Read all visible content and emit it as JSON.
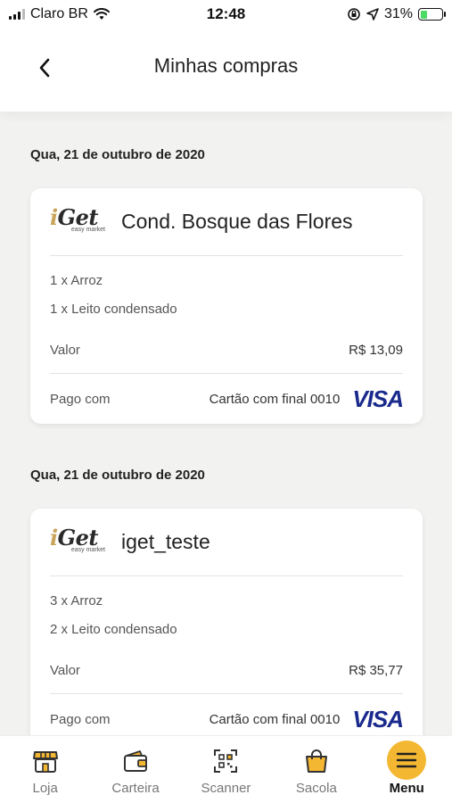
{
  "status": {
    "carrier": "Claro BR",
    "time": "12:48",
    "battery": "31%",
    "battery_level": 0.31
  },
  "header": {
    "title": "Minhas compras"
  },
  "orders": [
    {
      "date": "Qua, 21 de outubro de 2020",
      "logo": {
        "main": "iGet",
        "sub": "easy market"
      },
      "store": "Cond. Bosque das Flores",
      "items": [
        "1 x Arroz",
        "1 x Leito condensado"
      ],
      "valor_label": "Valor",
      "valor": "R$ 13,09",
      "pago_label": "Pago com",
      "card": "Cartão com final 0010",
      "brand": "VISA"
    },
    {
      "date": "Qua, 21 de outubro de 2020",
      "logo": {
        "main": "iGet",
        "sub": "easy market"
      },
      "store": "iget_teste",
      "items": [
        "3 x Arroz",
        "2 x Leito condensado"
      ],
      "valor_label": "Valor",
      "valor": "R$ 35,77",
      "pago_label": "Pago com",
      "card": "Cartão com final 0010",
      "brand": "VISA"
    }
  ],
  "tabs": [
    {
      "label": "Loja",
      "icon": "store-icon"
    },
    {
      "label": "Carteira",
      "icon": "wallet-icon"
    },
    {
      "label": "Scanner",
      "icon": "qr-scanner-icon"
    },
    {
      "label": "Sacola",
      "icon": "shopping-bag-icon"
    },
    {
      "label": "Menu",
      "icon": "hamburger-menu-icon",
      "active": true
    }
  ],
  "colors": {
    "accent": "#f4b731",
    "visa": "#1a2a8c",
    "logo_gold": "#c8a45a"
  }
}
